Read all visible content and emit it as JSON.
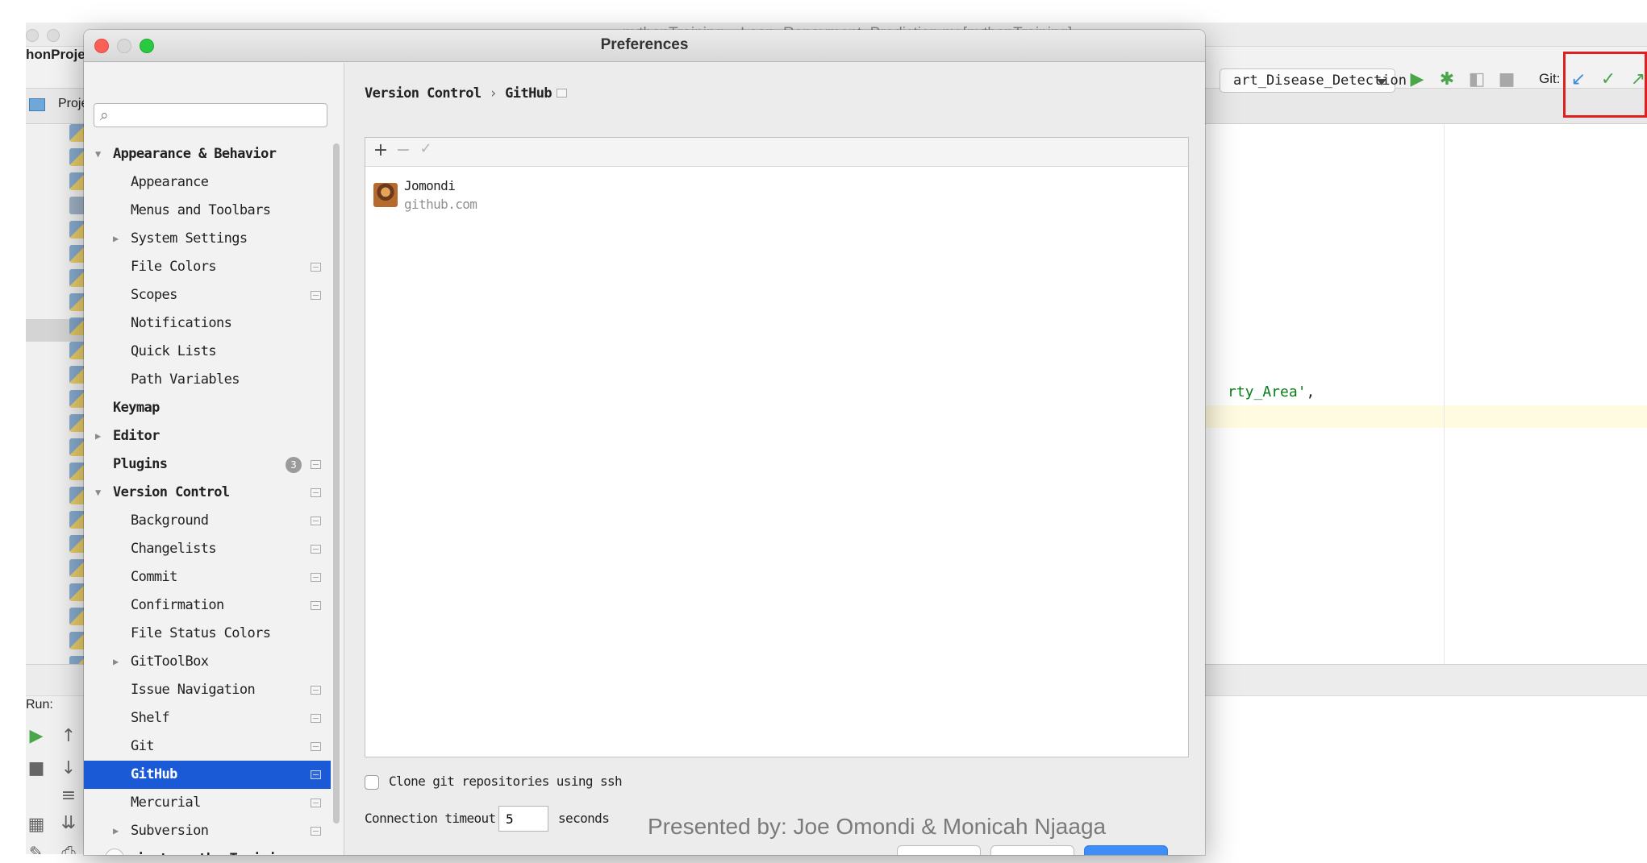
{
  "ide": {
    "title": "pythonTraining – Loan_Repayment_Prediction.py [pythonTraining]",
    "project_label": "honProjec",
    "project_tab": "Projec",
    "run_config": "art_Disease_Detection",
    "git_label": "Git:",
    "code_fragment_string": "rty_Area'",
    "code_fragment_punct": ",",
    "run_label": "Run:"
  },
  "dialog": {
    "title": "Preferences",
    "search_placeholder": "",
    "tree": [
      {
        "label": "Appearance & Behavior",
        "level": 0,
        "arrow": "expanded",
        "bold": true
      },
      {
        "label": "Appearance",
        "level": 1
      },
      {
        "label": "Menus and Toolbars",
        "level": 1
      },
      {
        "label": "System Settings",
        "level": 1,
        "arrow": "collapsed"
      },
      {
        "label": "File Colors",
        "level": 1,
        "project": true
      },
      {
        "label": "Scopes",
        "level": 1,
        "project": true
      },
      {
        "label": "Notifications",
        "level": 1
      },
      {
        "label": "Quick Lists",
        "level": 1
      },
      {
        "label": "Path Variables",
        "level": 1
      },
      {
        "label": "Keymap",
        "level": 0,
        "bold": true
      },
      {
        "label": "Editor",
        "level": 0,
        "arrow": "collapsed",
        "bold": true
      },
      {
        "label": "Plugins",
        "level": 0,
        "bold": true,
        "badge": "3",
        "project": true
      },
      {
        "label": "Version Control",
        "level": 0,
        "arrow": "expanded",
        "bold": true,
        "project": true
      },
      {
        "label": "Background",
        "level": 1,
        "project": true
      },
      {
        "label": "Changelists",
        "level": 1,
        "project": true
      },
      {
        "label": "Commit",
        "level": 1,
        "project": true
      },
      {
        "label": "Confirmation",
        "level": 1,
        "project": true
      },
      {
        "label": "File Status Colors",
        "level": 1
      },
      {
        "label": "GitToolBox",
        "level": 1,
        "arrow": "collapsed"
      },
      {
        "label": "Issue Navigation",
        "level": 1,
        "project": true
      },
      {
        "label": "Shelf",
        "level": 1,
        "project": true
      },
      {
        "label": "Git",
        "level": 1,
        "project": true
      },
      {
        "label": "GitHub",
        "level": 1,
        "project": true,
        "selected": true
      },
      {
        "label": "Mercurial",
        "level": 1,
        "project": true
      },
      {
        "label": "Subversion",
        "level": 1,
        "arrow": "collapsed",
        "project": true
      },
      {
        "label": "Project: pythonTraining",
        "level": 0,
        "arrow": "collapsed",
        "bold": true,
        "project": true
      }
    ],
    "breadcrumb": {
      "parent": "Version Control",
      "separator": "›",
      "current": "GitHub"
    },
    "accounts": {
      "tools": {
        "add": "+",
        "remove": "−",
        "default": "✓"
      },
      "items": [
        {
          "name": "Jomondi",
          "host": "github.com"
        }
      ]
    },
    "clone_ssh": {
      "label": "Clone git repositories using ssh",
      "checked": false
    },
    "timeout": {
      "label": "Connection timeout:",
      "value": "5",
      "unit": "seconds"
    }
  },
  "footer": {
    "presenter": "Presented by: Joe Omondi & Monicah Njaaga"
  },
  "colors": {
    "selection": "#1a5ad6",
    "highlight_box": "#e0201f",
    "git_update": "#3d8bd8",
    "git_commit": "#4aa64a",
    "git_push": "#4aa64a"
  }
}
